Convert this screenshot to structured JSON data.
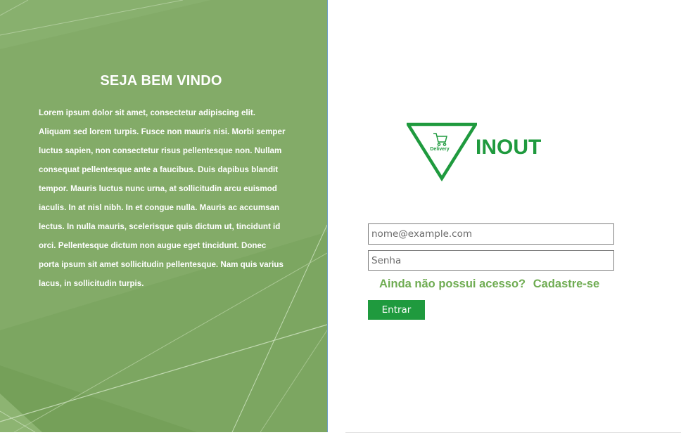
{
  "welcome": {
    "title": "SEJA BEM VINDO",
    "body": "Lorem ipsum dolor sit amet, consectetur adipiscing elit. Aliquam sed lorem turpis. Fusce non mauris nisi. Morbi semper luctus sapien, non consectetur risus pellentesque non. Nullam consequat pellentesque ante a faucibus. Duis dapibus blandit tempor. Mauris luctus nunc urna, at sollicitudin arcu euismod iaculis. In at nisl nibh. In et congue nulla. Mauris ac accumsan lectus. In nulla mauris, scelerisque quis dictum ut, tincidunt id orci. Pellentesque dictum non augue eget tincidunt. Donec porta ipsum sit amet sollicitudin pellentesque. Nam quis varius lacus, in sollicitudin turpis."
  },
  "logo": {
    "brand": "INOUT",
    "tagline": "Delivery",
    "icon": "shopping-cart-icon",
    "color": "#1f9a3e"
  },
  "login_form": {
    "email_placeholder": "nome@example.com",
    "email_value": "",
    "password_placeholder": "Senha",
    "password_value": "",
    "no_access_text": "Ainda não possui acesso?",
    "register_link": "Cadastre-se",
    "submit_label": "Entrar"
  },
  "colors": {
    "panel_green": "#83ab68",
    "accent_green": "#1f9a3e",
    "link_green": "#6fac52"
  }
}
